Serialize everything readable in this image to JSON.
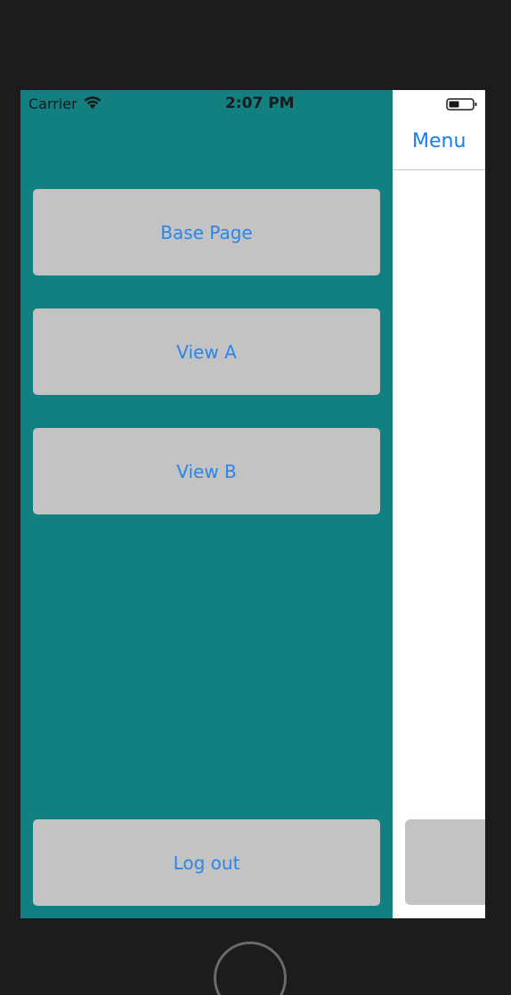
{
  "status_bar": {
    "carrier": "Carrier",
    "time": "2:07 PM",
    "wifi_icon": "wifi-icon",
    "battery_icon": "battery-icon"
  },
  "content_page": {
    "nav_title": "Menu"
  },
  "flyout": {
    "background_color": "#128080",
    "items": [
      {
        "label": "Base Page"
      },
      {
        "label": "View A"
      },
      {
        "label": "View B"
      }
    ],
    "logout_label": "Log out"
  },
  "colors": {
    "button_bg": "#c3c3c3",
    "link_blue": "#2a86e8",
    "device_bezel": "#1c1c1c"
  }
}
